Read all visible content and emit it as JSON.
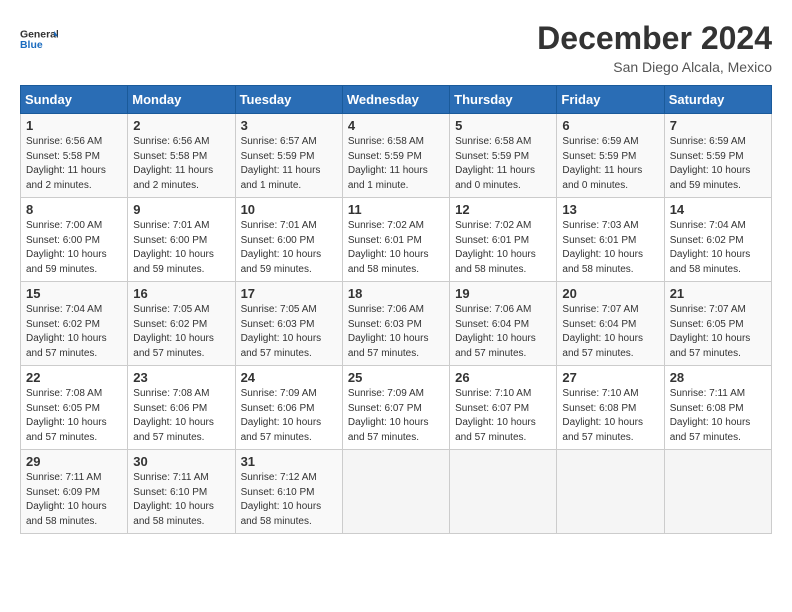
{
  "header": {
    "logo_text_general": "General",
    "logo_text_blue": "Blue",
    "month_year": "December 2024",
    "location": "San Diego Alcala, Mexico"
  },
  "weekdays": [
    "Sunday",
    "Monday",
    "Tuesday",
    "Wednesday",
    "Thursday",
    "Friday",
    "Saturday"
  ],
  "weeks": [
    [
      {
        "day": "1",
        "sunrise": "6:56 AM",
        "sunset": "5:58 PM",
        "daylight": "11 hours and 2 minutes."
      },
      {
        "day": "2",
        "sunrise": "6:56 AM",
        "sunset": "5:58 PM",
        "daylight": "11 hours and 2 minutes."
      },
      {
        "day": "3",
        "sunrise": "6:57 AM",
        "sunset": "5:59 PM",
        "daylight": "11 hours and 1 minute."
      },
      {
        "day": "4",
        "sunrise": "6:58 AM",
        "sunset": "5:59 PM",
        "daylight": "11 hours and 1 minute."
      },
      {
        "day": "5",
        "sunrise": "6:58 AM",
        "sunset": "5:59 PM",
        "daylight": "11 hours and 0 minutes."
      },
      {
        "day": "6",
        "sunrise": "6:59 AM",
        "sunset": "5:59 PM",
        "daylight": "11 hours and 0 minutes."
      },
      {
        "day": "7",
        "sunrise": "6:59 AM",
        "sunset": "5:59 PM",
        "daylight": "10 hours and 59 minutes."
      }
    ],
    [
      {
        "day": "8",
        "sunrise": "7:00 AM",
        "sunset": "6:00 PM",
        "daylight": "10 hours and 59 minutes."
      },
      {
        "day": "9",
        "sunrise": "7:01 AM",
        "sunset": "6:00 PM",
        "daylight": "10 hours and 59 minutes."
      },
      {
        "day": "10",
        "sunrise": "7:01 AM",
        "sunset": "6:00 PM",
        "daylight": "10 hours and 59 minutes."
      },
      {
        "day": "11",
        "sunrise": "7:02 AM",
        "sunset": "6:01 PM",
        "daylight": "10 hours and 58 minutes."
      },
      {
        "day": "12",
        "sunrise": "7:02 AM",
        "sunset": "6:01 PM",
        "daylight": "10 hours and 58 minutes."
      },
      {
        "day": "13",
        "sunrise": "7:03 AM",
        "sunset": "6:01 PM",
        "daylight": "10 hours and 58 minutes."
      },
      {
        "day": "14",
        "sunrise": "7:04 AM",
        "sunset": "6:02 PM",
        "daylight": "10 hours and 58 minutes."
      }
    ],
    [
      {
        "day": "15",
        "sunrise": "7:04 AM",
        "sunset": "6:02 PM",
        "daylight": "10 hours and 57 minutes."
      },
      {
        "day": "16",
        "sunrise": "7:05 AM",
        "sunset": "6:02 PM",
        "daylight": "10 hours and 57 minutes."
      },
      {
        "day": "17",
        "sunrise": "7:05 AM",
        "sunset": "6:03 PM",
        "daylight": "10 hours and 57 minutes."
      },
      {
        "day": "18",
        "sunrise": "7:06 AM",
        "sunset": "6:03 PM",
        "daylight": "10 hours and 57 minutes."
      },
      {
        "day": "19",
        "sunrise": "7:06 AM",
        "sunset": "6:04 PM",
        "daylight": "10 hours and 57 minutes."
      },
      {
        "day": "20",
        "sunrise": "7:07 AM",
        "sunset": "6:04 PM",
        "daylight": "10 hours and 57 minutes."
      },
      {
        "day": "21",
        "sunrise": "7:07 AM",
        "sunset": "6:05 PM",
        "daylight": "10 hours and 57 minutes."
      }
    ],
    [
      {
        "day": "22",
        "sunrise": "7:08 AM",
        "sunset": "6:05 PM",
        "daylight": "10 hours and 57 minutes."
      },
      {
        "day": "23",
        "sunrise": "7:08 AM",
        "sunset": "6:06 PM",
        "daylight": "10 hours and 57 minutes."
      },
      {
        "day": "24",
        "sunrise": "7:09 AM",
        "sunset": "6:06 PM",
        "daylight": "10 hours and 57 minutes."
      },
      {
        "day": "25",
        "sunrise": "7:09 AM",
        "sunset": "6:07 PM",
        "daylight": "10 hours and 57 minutes."
      },
      {
        "day": "26",
        "sunrise": "7:10 AM",
        "sunset": "6:07 PM",
        "daylight": "10 hours and 57 minutes."
      },
      {
        "day": "27",
        "sunrise": "7:10 AM",
        "sunset": "6:08 PM",
        "daylight": "10 hours and 57 minutes."
      },
      {
        "day": "28",
        "sunrise": "7:11 AM",
        "sunset": "6:08 PM",
        "daylight": "10 hours and 57 minutes."
      }
    ],
    [
      {
        "day": "29",
        "sunrise": "7:11 AM",
        "sunset": "6:09 PM",
        "daylight": "10 hours and 58 minutes."
      },
      {
        "day": "30",
        "sunrise": "7:11 AM",
        "sunset": "6:10 PM",
        "daylight": "10 hours and 58 minutes."
      },
      {
        "day": "31",
        "sunrise": "7:12 AM",
        "sunset": "6:10 PM",
        "daylight": "10 hours and 58 minutes."
      },
      null,
      null,
      null,
      null
    ]
  ],
  "labels": {
    "sunrise": "Sunrise:",
    "sunset": "Sunset:",
    "daylight": "Daylight:"
  }
}
